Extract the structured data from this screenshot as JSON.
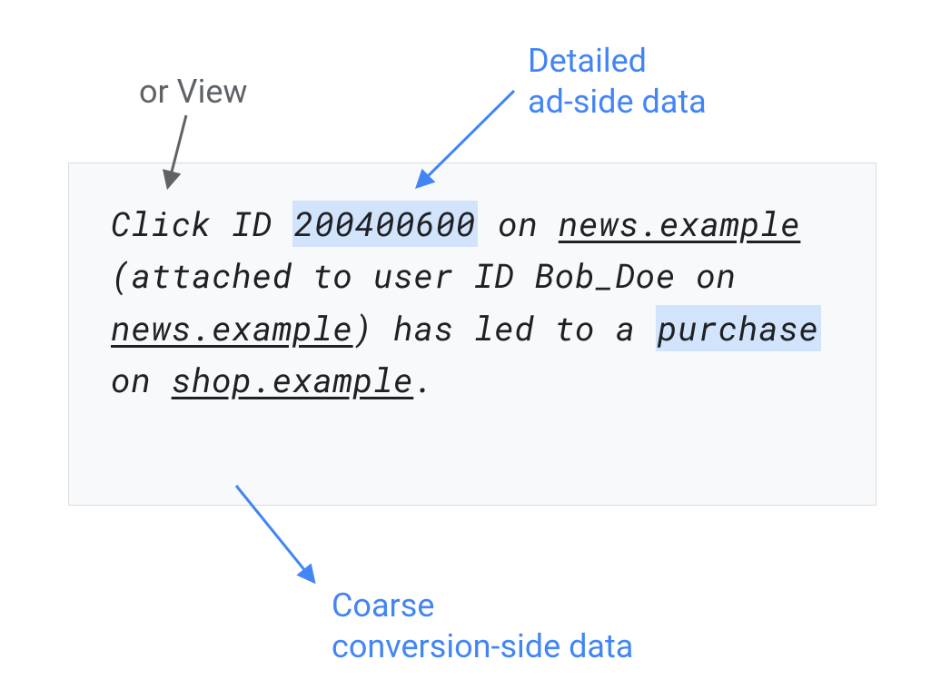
{
  "annotations": {
    "view_label": "or View",
    "detailed_label": "Detailed\nad-side data",
    "coarse_label": "Coarse\nconversion-side data"
  },
  "sentence": {
    "p1": "Click ID ",
    "click_id": "200400600",
    "p2": " on ",
    "site1": "news.example",
    "p3": " (attached to user ID Bob_Doe on ",
    "site2": "news.example",
    "p4": ") has led to a ",
    "purchase": "purchase",
    "p5": " on ",
    "site3": "shop.example",
    "p6": "."
  },
  "colors": {
    "highlight": "#d2e3fc",
    "blue": "#4285f4",
    "gray": "#5f6368",
    "box_bg": "#f8f9fa",
    "box_border": "#dadce0"
  }
}
